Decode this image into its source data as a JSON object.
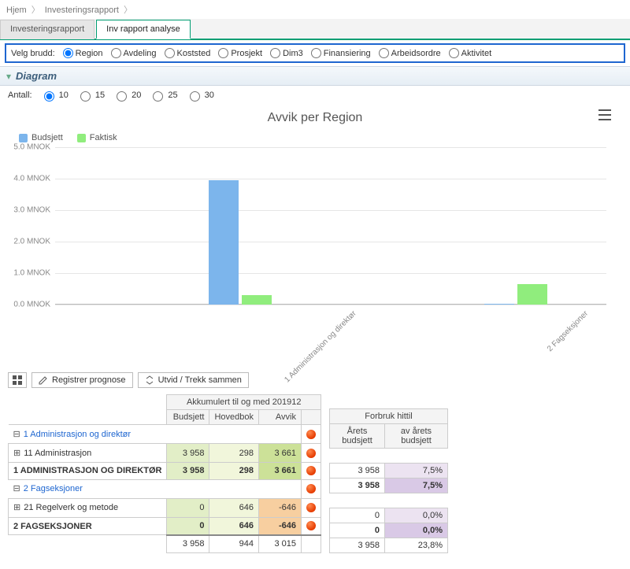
{
  "breadcrumb": {
    "home": "Hjem",
    "page": "Investeringsrapport"
  },
  "tabs": {
    "report": "Investeringsrapport",
    "analyse": "Inv rapport analyse"
  },
  "filter": {
    "label": "Velg brudd:",
    "options": [
      "Region",
      "Avdeling",
      "Koststed",
      "Prosjekt",
      "Dim3",
      "Finansiering",
      "Arbeidsordre",
      "Aktivitet"
    ],
    "selected": "Region"
  },
  "section_title": "Diagram",
  "antall": {
    "label": "Antall:",
    "options": [
      "10",
      "15",
      "20",
      "25",
      "30"
    ],
    "selected": "10"
  },
  "chart_data": {
    "type": "bar",
    "title": "Avvik per Region",
    "ylabel": "MNOK",
    "yticks": [
      0,
      1,
      2,
      3,
      4,
      5
    ],
    "ylim": [
      0,
      5
    ],
    "categories": [
      "1 Administrasjon og direktør",
      "2 Fagseksjoner"
    ],
    "series": [
      {
        "name": "Budsjett",
        "color": "#7cb5ec",
        "values": [
          3.958,
          0.0
        ]
      },
      {
        "name": "Faktisk",
        "color": "#90ed7d",
        "values": [
          0.298,
          0.646
        ]
      }
    ]
  },
  "legend": {
    "budsjett": "Budsjett",
    "faktisk": "Faktisk"
  },
  "toolbar": {
    "grid_icon": "grid",
    "registrer": "Registrer prognose",
    "utvid": "Utvid / Trekk sammen"
  },
  "table": {
    "group_header": "Akkumulert til og med 201912",
    "cols": {
      "budsjett": "Budsjett",
      "hovedbok": "Hovedbok",
      "avvik": "Avvik",
      "status": ""
    },
    "right_group": "Forbruk hittil",
    "right_cols": {
      "aarets": "Årets budsjett",
      "av": "av årets budsjett"
    },
    "groups": [
      {
        "label": "1 Administrasjon og direktør",
        "items": [
          {
            "label": "11 Administrasjon",
            "budsjett": "3 958",
            "hovedbok": "298",
            "avvik": "3 661",
            "status": "red",
            "aarets": "3 958",
            "av": "7,5%"
          }
        ],
        "total": {
          "label": "1 ADMINISTRASJON OG DIREKTØR",
          "budsjett": "3 958",
          "hovedbok": "298",
          "avvik": "3 661",
          "status": "red",
          "aarets": "3 958",
          "av": "7,5%"
        }
      },
      {
        "label": "2 Fagseksjoner",
        "items": [
          {
            "label": "21 Regelverk og metode",
            "budsjett": "0",
            "hovedbok": "646",
            "avvik": "-646",
            "status": "red",
            "aarets": "0",
            "av": "0,0%"
          }
        ],
        "total": {
          "label": "2 FAGSEKSJONER",
          "budsjett": "0",
          "hovedbok": "646",
          "avvik": "-646",
          "status": "red",
          "aarets": "0",
          "av": "0,0%"
        }
      }
    ],
    "grand": {
      "budsjett": "3 958",
      "hovedbok": "944",
      "avvik": "3 015",
      "aarets": "3 958",
      "av": "23,8%"
    },
    "red_status_top": "red"
  }
}
